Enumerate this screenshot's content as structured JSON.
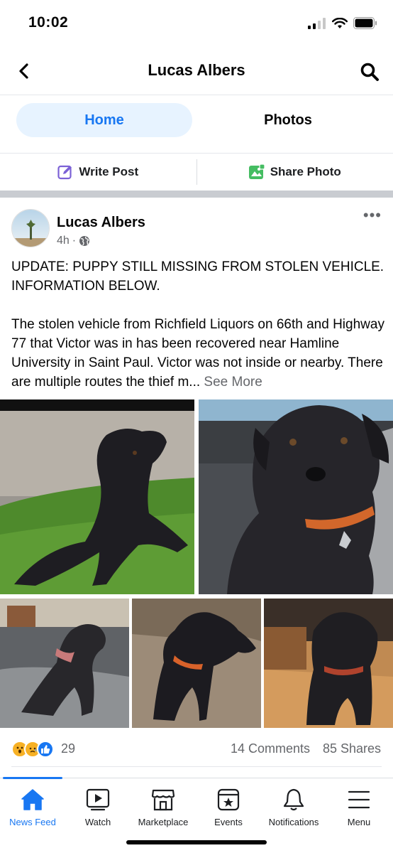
{
  "status": {
    "time": "10:02"
  },
  "header": {
    "title": "Lucas Albers"
  },
  "tabs": [
    {
      "label": "Home",
      "active": true
    },
    {
      "label": "Photos",
      "active": false
    }
  ],
  "actions": {
    "write_post": "Write Post",
    "share_photo": "Share Photo"
  },
  "post": {
    "author": "Lucas Albers",
    "time": "4h",
    "separator": "·",
    "more": "•••",
    "paragraph1": "UPDATE: PUPPY STILL MISSING FROM STOLEN VEHICLE. INFORMATION BELOW.",
    "paragraph2": "The stolen vehicle from Richfield Liquors on 66th and Highway 77 that Victor was in has been recovered near Hamline University in Saint Paul. Victor was not inside or nearby. There are multiple routes the thief m...",
    "see_more": "See More",
    "reaction_count": "29",
    "comments": "14 Comments",
    "shares": "85 Shares"
  },
  "nav": [
    {
      "label": "News Feed",
      "icon": "home-icon",
      "active": true
    },
    {
      "label": "Watch",
      "icon": "watch-icon",
      "active": false
    },
    {
      "label": "Marketplace",
      "icon": "marketplace-icon",
      "active": false
    },
    {
      "label": "Events",
      "icon": "events-icon",
      "active": false
    },
    {
      "label": "Notifications",
      "icon": "bell-icon",
      "active": false
    },
    {
      "label": "Menu",
      "icon": "menu-icon",
      "active": false
    }
  ],
  "colors": {
    "accent": "#1877f2",
    "tab_active_bg": "#e7f3ff",
    "secondary_text": "#65676b"
  }
}
